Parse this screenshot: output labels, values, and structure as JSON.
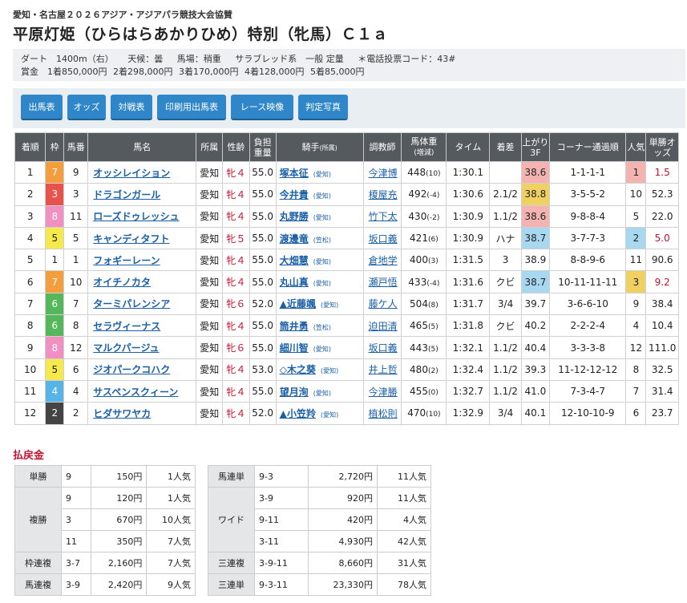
{
  "header": {
    "sponsor": "愛知・名古屋２０２６アジア・アジアパラ競技大会協賛",
    "title": "平原灯姫（ひらはらあかりひめ）特別（牝馬）Ｃ１ａ"
  },
  "info": {
    "line1": [
      "ダート　1400m（右）",
      "天候：曇",
      "馬場：稍重",
      "サラブレッド系　一般 定量",
      "＊電話投票コード：43#"
    ],
    "line2": [
      "賞金　1着850,000円",
      "2着298,000円",
      "3着170,000円",
      "4着128,000円",
      "5着85,000円"
    ]
  },
  "buttons": [
    "出馬表",
    "オッズ",
    "対戦表",
    "印刷用出馬表",
    "レース映像",
    "判定写真"
  ],
  "columns": [
    "着順",
    "枠",
    "馬番",
    "馬名",
    "所属",
    "性齢",
    "負担重量",
    "騎手",
    "(所属)",
    "調教師",
    "馬体重",
    "(増減)",
    "タイム",
    "着差",
    "上がり3F",
    "コーナー通過順",
    "人気",
    "単勝オッズ"
  ],
  "rows": [
    {
      "rank": "1",
      "waku": "7",
      "num": "9",
      "name": "オッシレイション",
      "belong": "愛知",
      "sex": "牝４",
      "wt": "55.0",
      "jockey": "塚本征",
      "jb": "(愛知)",
      "trainer": "今津博",
      "bw": "448",
      "bwc": "(10)",
      "time": "1:30.1",
      "margin": "",
      "last3f": "38.6",
      "corner": "1-1-1-1",
      "pop": "1",
      "odds": "1.5"
    },
    {
      "rank": "2",
      "waku": "3",
      "num": "3",
      "name": "ドラゴンガール",
      "belong": "愛知",
      "sex": "牝４",
      "wt": "55.0",
      "jockey": "今井貴",
      "jb": "(愛知)",
      "trainer": "榎屋充",
      "bw": "492",
      "bwc": "(-4)",
      "time": "1:30.6",
      "margin": "2.1/2",
      "last3f": "38.8",
      "corner": "3-5-5-2",
      "pop": "10",
      "odds": "52.3"
    },
    {
      "rank": "3",
      "waku": "8",
      "num": "11",
      "name": "ローズドゥレッシュ",
      "belong": "愛知",
      "sex": "牝４",
      "wt": "55.0",
      "jockey": "丸野勝",
      "jb": "(愛知)",
      "trainer": "竹下太",
      "bw": "430",
      "bwc": "(-2)",
      "time": "1:30.9",
      "margin": "1.1/2",
      "last3f": "38.6",
      "corner": "9-8-8-4",
      "pop": "5",
      "odds": "22.0"
    },
    {
      "rank": "4",
      "waku": "5",
      "num": "5",
      "name": "キャンディタフト",
      "belong": "愛知",
      "sex": "牝５",
      "wt": "55.0",
      "jockey": "渡邊竜",
      "jb": "(笠松)",
      "trainer": "坂口義",
      "bw": "421",
      "bwc": "(6)",
      "time": "1:30.9",
      "margin": "ハナ",
      "last3f": "38.7",
      "corner": "3-7-7-3",
      "pop": "2",
      "odds": "5.0"
    },
    {
      "rank": "5",
      "waku": "1",
      "num": "1",
      "name": "フォギーレーン",
      "belong": "愛知",
      "sex": "牝４",
      "wt": "55.0",
      "jockey": "大畑慧",
      "jb": "(愛知)",
      "trainer": "倉地学",
      "bw": "400",
      "bwc": "(3)",
      "time": "1:31.5",
      "margin": "3",
      "last3f": "38.9",
      "corner": "8-8-9-6",
      "pop": "11",
      "odds": "90.6"
    },
    {
      "rank": "6",
      "waku": "7",
      "num": "10",
      "name": "オイチノカタ",
      "belong": "愛知",
      "sex": "牝４",
      "wt": "55.0",
      "jockey": "丸山真",
      "jb": "(愛知)",
      "trainer": "瀬戸悟",
      "bw": "433",
      "bwc": "(-4)",
      "time": "1:31.6",
      "margin": "クビ",
      "last3f": "38.7",
      "corner": "10-11-11-11",
      "pop": "3",
      "odds": "9.2"
    },
    {
      "rank": "7",
      "waku": "6",
      "num": "7",
      "name": "ターミパレンシア",
      "belong": "愛知",
      "sex": "牝６",
      "wt": "52.0",
      "jockey": "▲近藤颯",
      "jb": "(愛知)",
      "trainer": "藤ケ人",
      "bw": "504",
      "bwc": "(8)",
      "time": "1:31.7",
      "margin": "3/4",
      "last3f": "39.7",
      "corner": "3-6-6-10",
      "pop": "9",
      "odds": "38.4"
    },
    {
      "rank": "8",
      "waku": "6",
      "num": "8",
      "name": "セラヴィーナス",
      "belong": "愛知",
      "sex": "牝４",
      "wt": "55.0",
      "jockey": "筒井勇",
      "jb": "(笠松)",
      "trainer": "迫田清",
      "bw": "465",
      "bwc": "(5)",
      "time": "1:31.8",
      "margin": "クビ",
      "last3f": "40.2",
      "corner": "2-2-2-4",
      "pop": "4",
      "odds": "10.4"
    },
    {
      "rank": "9",
      "waku": "8",
      "num": "12",
      "name": "マルクパージュ",
      "belong": "愛知",
      "sex": "牝６",
      "wt": "55.0",
      "jockey": "細川智",
      "jb": "(愛知)",
      "trainer": "坂口義",
      "bw": "443",
      "bwc": "(5)",
      "time": "1:32.1",
      "margin": "1.1/2",
      "last3f": "40.4",
      "corner": "3-3-3-8",
      "pop": "12",
      "odds": "111.0"
    },
    {
      "rank": "10",
      "waku": "5",
      "num": "6",
      "name": "ジオパークコハク",
      "belong": "愛知",
      "sex": "牝４",
      "wt": "53.0",
      "jockey": "◇木之葵",
      "jb": "(愛知)",
      "trainer": "井上哲",
      "bw": "480",
      "bwc": "(2)",
      "time": "1:32.4",
      "margin": "1.1/2",
      "last3f": "39.3",
      "corner": "11-12-12-12",
      "pop": "8",
      "odds": "32.5"
    },
    {
      "rank": "11",
      "waku": "4",
      "num": "4",
      "name": "サスペンスクィーン",
      "belong": "愛知",
      "sex": "牝４",
      "wt": "55.0",
      "jockey": "望月洵",
      "jb": "(愛知)",
      "trainer": "今津勝",
      "bw": "455",
      "bwc": "(0)",
      "time": "1:32.7",
      "margin": "1.1/2",
      "last3f": "41.0",
      "corner": "7-3-4-7",
      "pop": "7",
      "odds": "31.4"
    },
    {
      "rank": "12",
      "waku": "2",
      "num": "2",
      "name": "ヒダサワヤカ",
      "belong": "愛知",
      "sex": "牝４",
      "wt": "52.0",
      "jockey": "▲小笠羚",
      "jb": "(愛知)",
      "trainer": "植松則",
      "bw": "470",
      "bwc": "(10)",
      "time": "1:32.9",
      "margin": "3/4",
      "last3f": "40.1",
      "corner": "12-10-10-9",
      "pop": "6",
      "odds": "23.7"
    }
  ],
  "payout": {
    "title": "払戻金",
    "left": [
      {
        "type": "単勝",
        "combo": "9",
        "amount": "150円",
        "pop": "1人気"
      },
      {
        "type": "複勝",
        "combo": "9",
        "amount": "120円",
        "pop": "1人気"
      },
      {
        "type": "",
        "combo": "3",
        "amount": "670円",
        "pop": "10人気"
      },
      {
        "type": "",
        "combo": "11",
        "amount": "350円",
        "pop": "7人気"
      },
      {
        "type": "枠連複",
        "combo": "3-7",
        "amount": "2,160円",
        "pop": "7人気"
      },
      {
        "type": "馬連複",
        "combo": "3-9",
        "amount": "2,420円",
        "pop": "9人気"
      }
    ],
    "right": [
      {
        "type": "馬連単",
        "combo": "9-3",
        "amount": "2,720円",
        "pop": "11人気"
      },
      {
        "type": "ワイド",
        "combo": "3-9",
        "amount": "920円",
        "pop": "11人気"
      },
      {
        "type": "",
        "combo": "9-11",
        "amount": "420円",
        "pop": "4人気"
      },
      {
        "type": "",
        "combo": "3-11",
        "amount": "4,930円",
        "pop": "42人気"
      },
      {
        "type": "三連複",
        "combo": "3-9-11",
        "amount": "8,660円",
        "pop": "31人気"
      },
      {
        "type": "三連単",
        "combo": "9-3-11",
        "amount": "23,330円",
        "pop": "78人気"
      }
    ]
  }
}
